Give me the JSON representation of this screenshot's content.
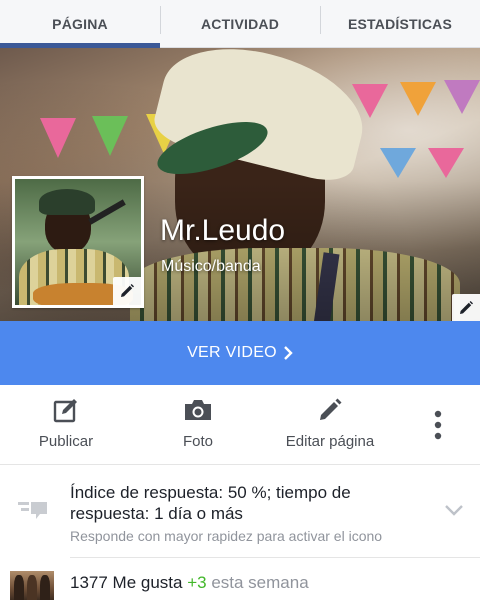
{
  "tabs": [
    {
      "label": "PÁGINA",
      "active": true
    },
    {
      "label": "ACTIVIDAD",
      "active": false
    },
    {
      "label": "ESTADÍSTICAS",
      "active": false
    }
  ],
  "page": {
    "name": "Mr.Leudo",
    "category": "Músico/banda"
  },
  "cta": {
    "label": "VER VIDEO",
    "icon": "chevron-right-icon"
  },
  "actions": [
    {
      "label": "Publicar",
      "icon": "compose-icon"
    },
    {
      "label": "Foto",
      "icon": "camera-icon"
    },
    {
      "label": "Editar página",
      "icon": "pencil-icon"
    }
  ],
  "more_icon": "more-vertical-icon",
  "response": {
    "title": "Índice de respuesta: 50 %; tiempo de respuesta: 1 día o más",
    "subtitle": "Responde con mayor rapidez para activar el icono",
    "icon": "chat-bubbles-icon"
  },
  "likes": {
    "count_label": "1377 Me gusta",
    "delta": "+3",
    "period": "esta semana"
  },
  "colors": {
    "brand": "#3b5998",
    "cta": "#4d88ee",
    "positive": "#42b72a",
    "muted": "#90949c"
  }
}
